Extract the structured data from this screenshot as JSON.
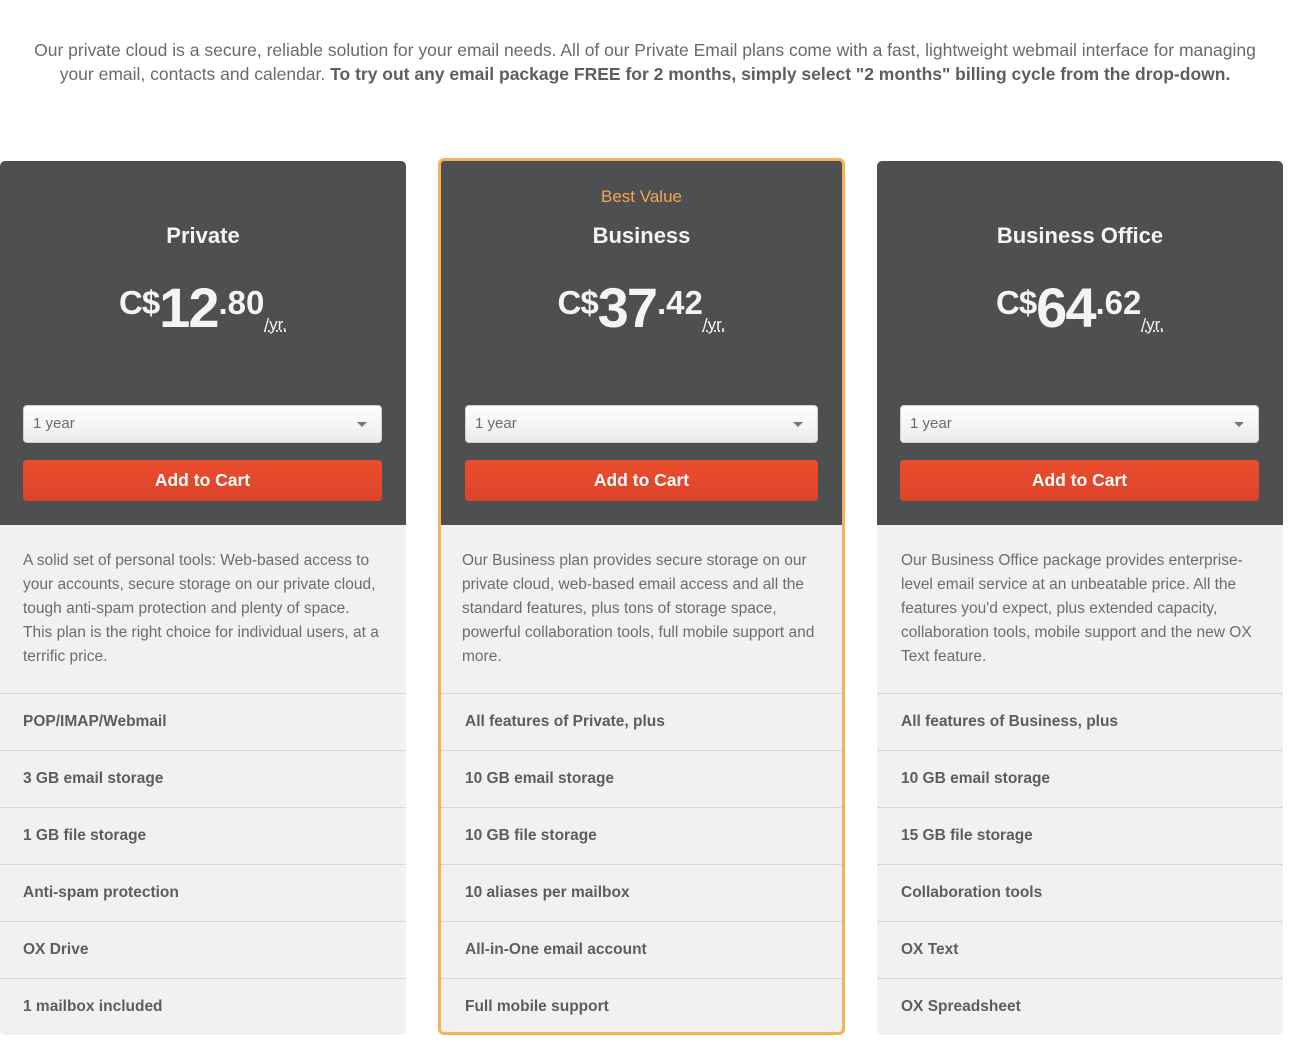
{
  "intro": {
    "text": "Our private cloud is a secure, reliable solution for your email needs. All of our Private Email plans come with a fast, lightweight webmail interface for managing your email, contacts and calendar. ",
    "bold_text": "To try out any email package FREE for 2 months, simply select \"2 months\" billing cycle from the drop-down."
  },
  "colors": {
    "card_header": "#4e4f51",
    "card_body": "#f1f1f1",
    "accent_orange": "#f6b25a",
    "badge_text": "#f3a556",
    "add_to_cart": "#e64a2d"
  },
  "plans": [
    {
      "name": "Private",
      "badge": "",
      "currency": "C$",
      "price_int": "12",
      "price_dec": ".80",
      "period": "/yr.",
      "billing_cycle": "1 year",
      "button_label": "Add to Cart",
      "description": "A solid set of personal tools: Web-based access to your accounts, secure storage on our private cloud, tough anti-spam protection and plenty of space. This plan is the right choice for individual users, at a terrific price.",
      "features": [
        "POP/IMAP/Webmail",
        "3 GB email storage",
        "1 GB file storage",
        "Anti-spam protection",
        "OX Drive",
        "1 mailbox included"
      ]
    },
    {
      "name": "Business",
      "badge": "Best Value",
      "currency": "C$",
      "price_int": "37",
      "price_dec": ".42",
      "period": "/yr.",
      "billing_cycle": "1 year",
      "button_label": "Add to Cart",
      "description": "Our Business plan provides secure storage on our private cloud, web-based email access and all the standard features, plus tons of storage space, powerful collaboration tools, full mobile support and more.",
      "features": [
        "All features of Private, plus",
        "10 GB email storage",
        "10 GB file storage",
        "10 aliases per mailbox",
        "All-in-One email account",
        "Full mobile support"
      ]
    },
    {
      "name": "Business Office",
      "badge": "",
      "currency": "C$",
      "price_int": "64",
      "price_dec": ".62",
      "period": "/yr.",
      "billing_cycle": "1 year",
      "button_label": "Add to Cart",
      "description": "Our Business Office package provides enterprise-level email service at an unbeatable price. All the features you'd expect, plus extended capacity, collaboration tools, mobile support and the new OX Text feature.",
      "features": [
        "All features of Business, plus",
        "10 GB email storage",
        "15 GB file storage",
        "Collaboration tools",
        "OX Text",
        "OX Spreadsheet"
      ]
    }
  ]
}
